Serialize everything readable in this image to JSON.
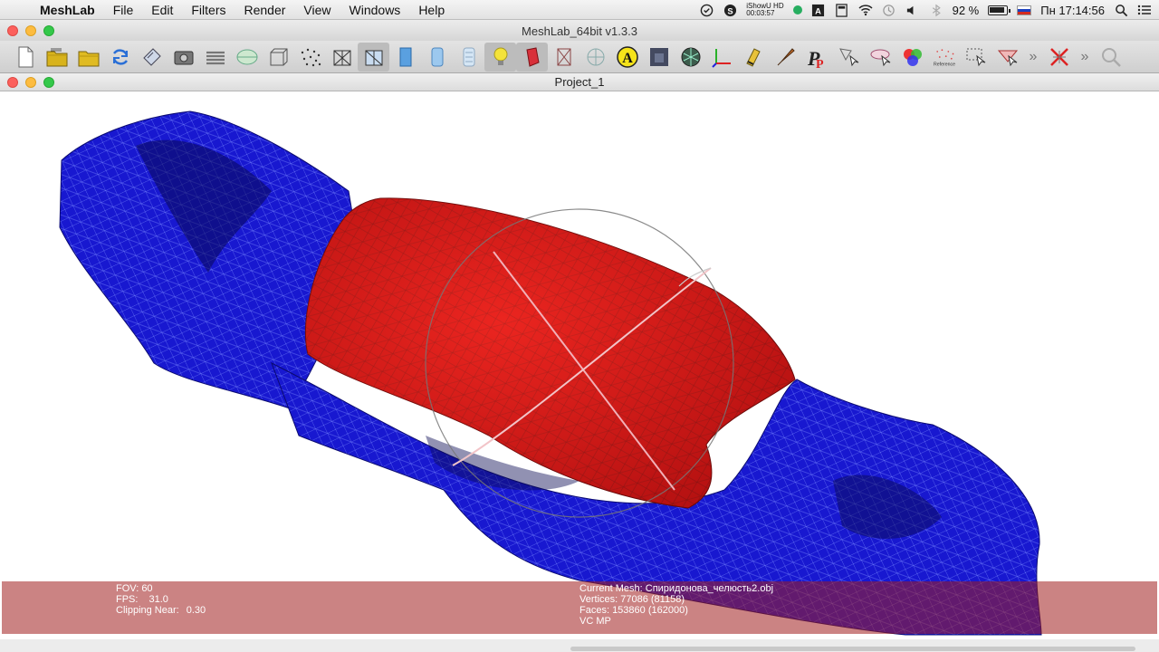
{
  "menubar": {
    "app_name": "MeshLab",
    "items": [
      "File",
      "Edit",
      "Filters",
      "Render",
      "View",
      "Windows",
      "Help"
    ],
    "recorder_title": "iShowU HD",
    "recorder_time": "00:03:57",
    "battery": "92 %",
    "clock": "Пн 17:14:56"
  },
  "window": {
    "title": "MeshLab_64bit v1.3.3"
  },
  "toolbar": {
    "icons": [
      "new-project-icon",
      "open-project-icon",
      "open-mesh-icon",
      "reload-icon",
      "save-icon",
      "snapshot-icon",
      "layers-icon",
      "globe-icon",
      "bounding-box-icon",
      "points-icon",
      "wireframe-icon",
      "hidden-lines-icon",
      "flat-icon",
      "smooth-icon",
      "texture-icon",
      "light-icon",
      "double-side-icon",
      "backface-icon",
      "grid-icon",
      "color-icon",
      "selected-icon",
      "decorate-icon",
      "axis-icon",
      "paint-icon",
      "brush-icon",
      "pick-icon",
      "select-icon",
      "align-icon",
      "rgb-icon",
      "reference-icon",
      "select-faces-icon",
      "measure-icon",
      "delete-icon",
      "search-icon"
    ],
    "reference_label": "Reference"
  },
  "subwindow": {
    "title": "Project_1"
  },
  "info": {
    "fov_label": "FOV: 60",
    "fps_label": "FPS:",
    "fps_value": "31.0",
    "clip_label": "Clipping Near:",
    "clip_value": "0.30",
    "current_mesh": "Current Mesh: Спиридонова_челюсть2.obj",
    "vertices": "Vertices: 77086 (81158)",
    "faces": "Faces: 153860 (162000)",
    "vc": "VC MP"
  },
  "colors": {
    "mesh_blue": "#1a1ad6",
    "mesh_red": "#e01818",
    "info_bar": "#a01e1e"
  }
}
